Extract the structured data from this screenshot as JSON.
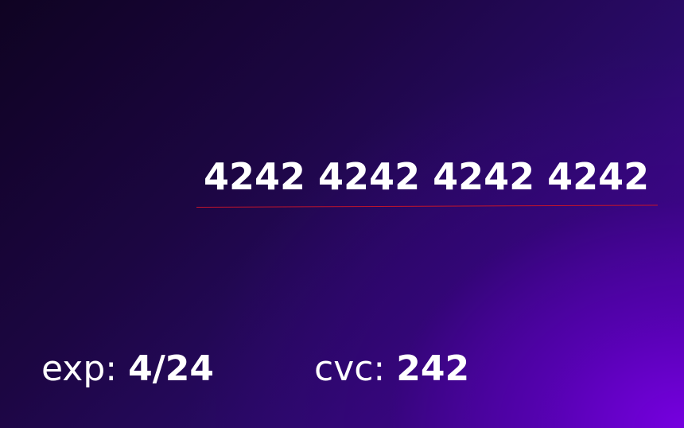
{
  "card": {
    "number": "4242 4242 4242 4242",
    "exp_label": "exp:",
    "exp_value": "4/24",
    "cvc_label": "cvc:",
    "cvc_value": "242"
  },
  "colors": {
    "underline": "#c0142c",
    "text": "#ffffff",
    "gradient_accent": "#7600e0"
  }
}
